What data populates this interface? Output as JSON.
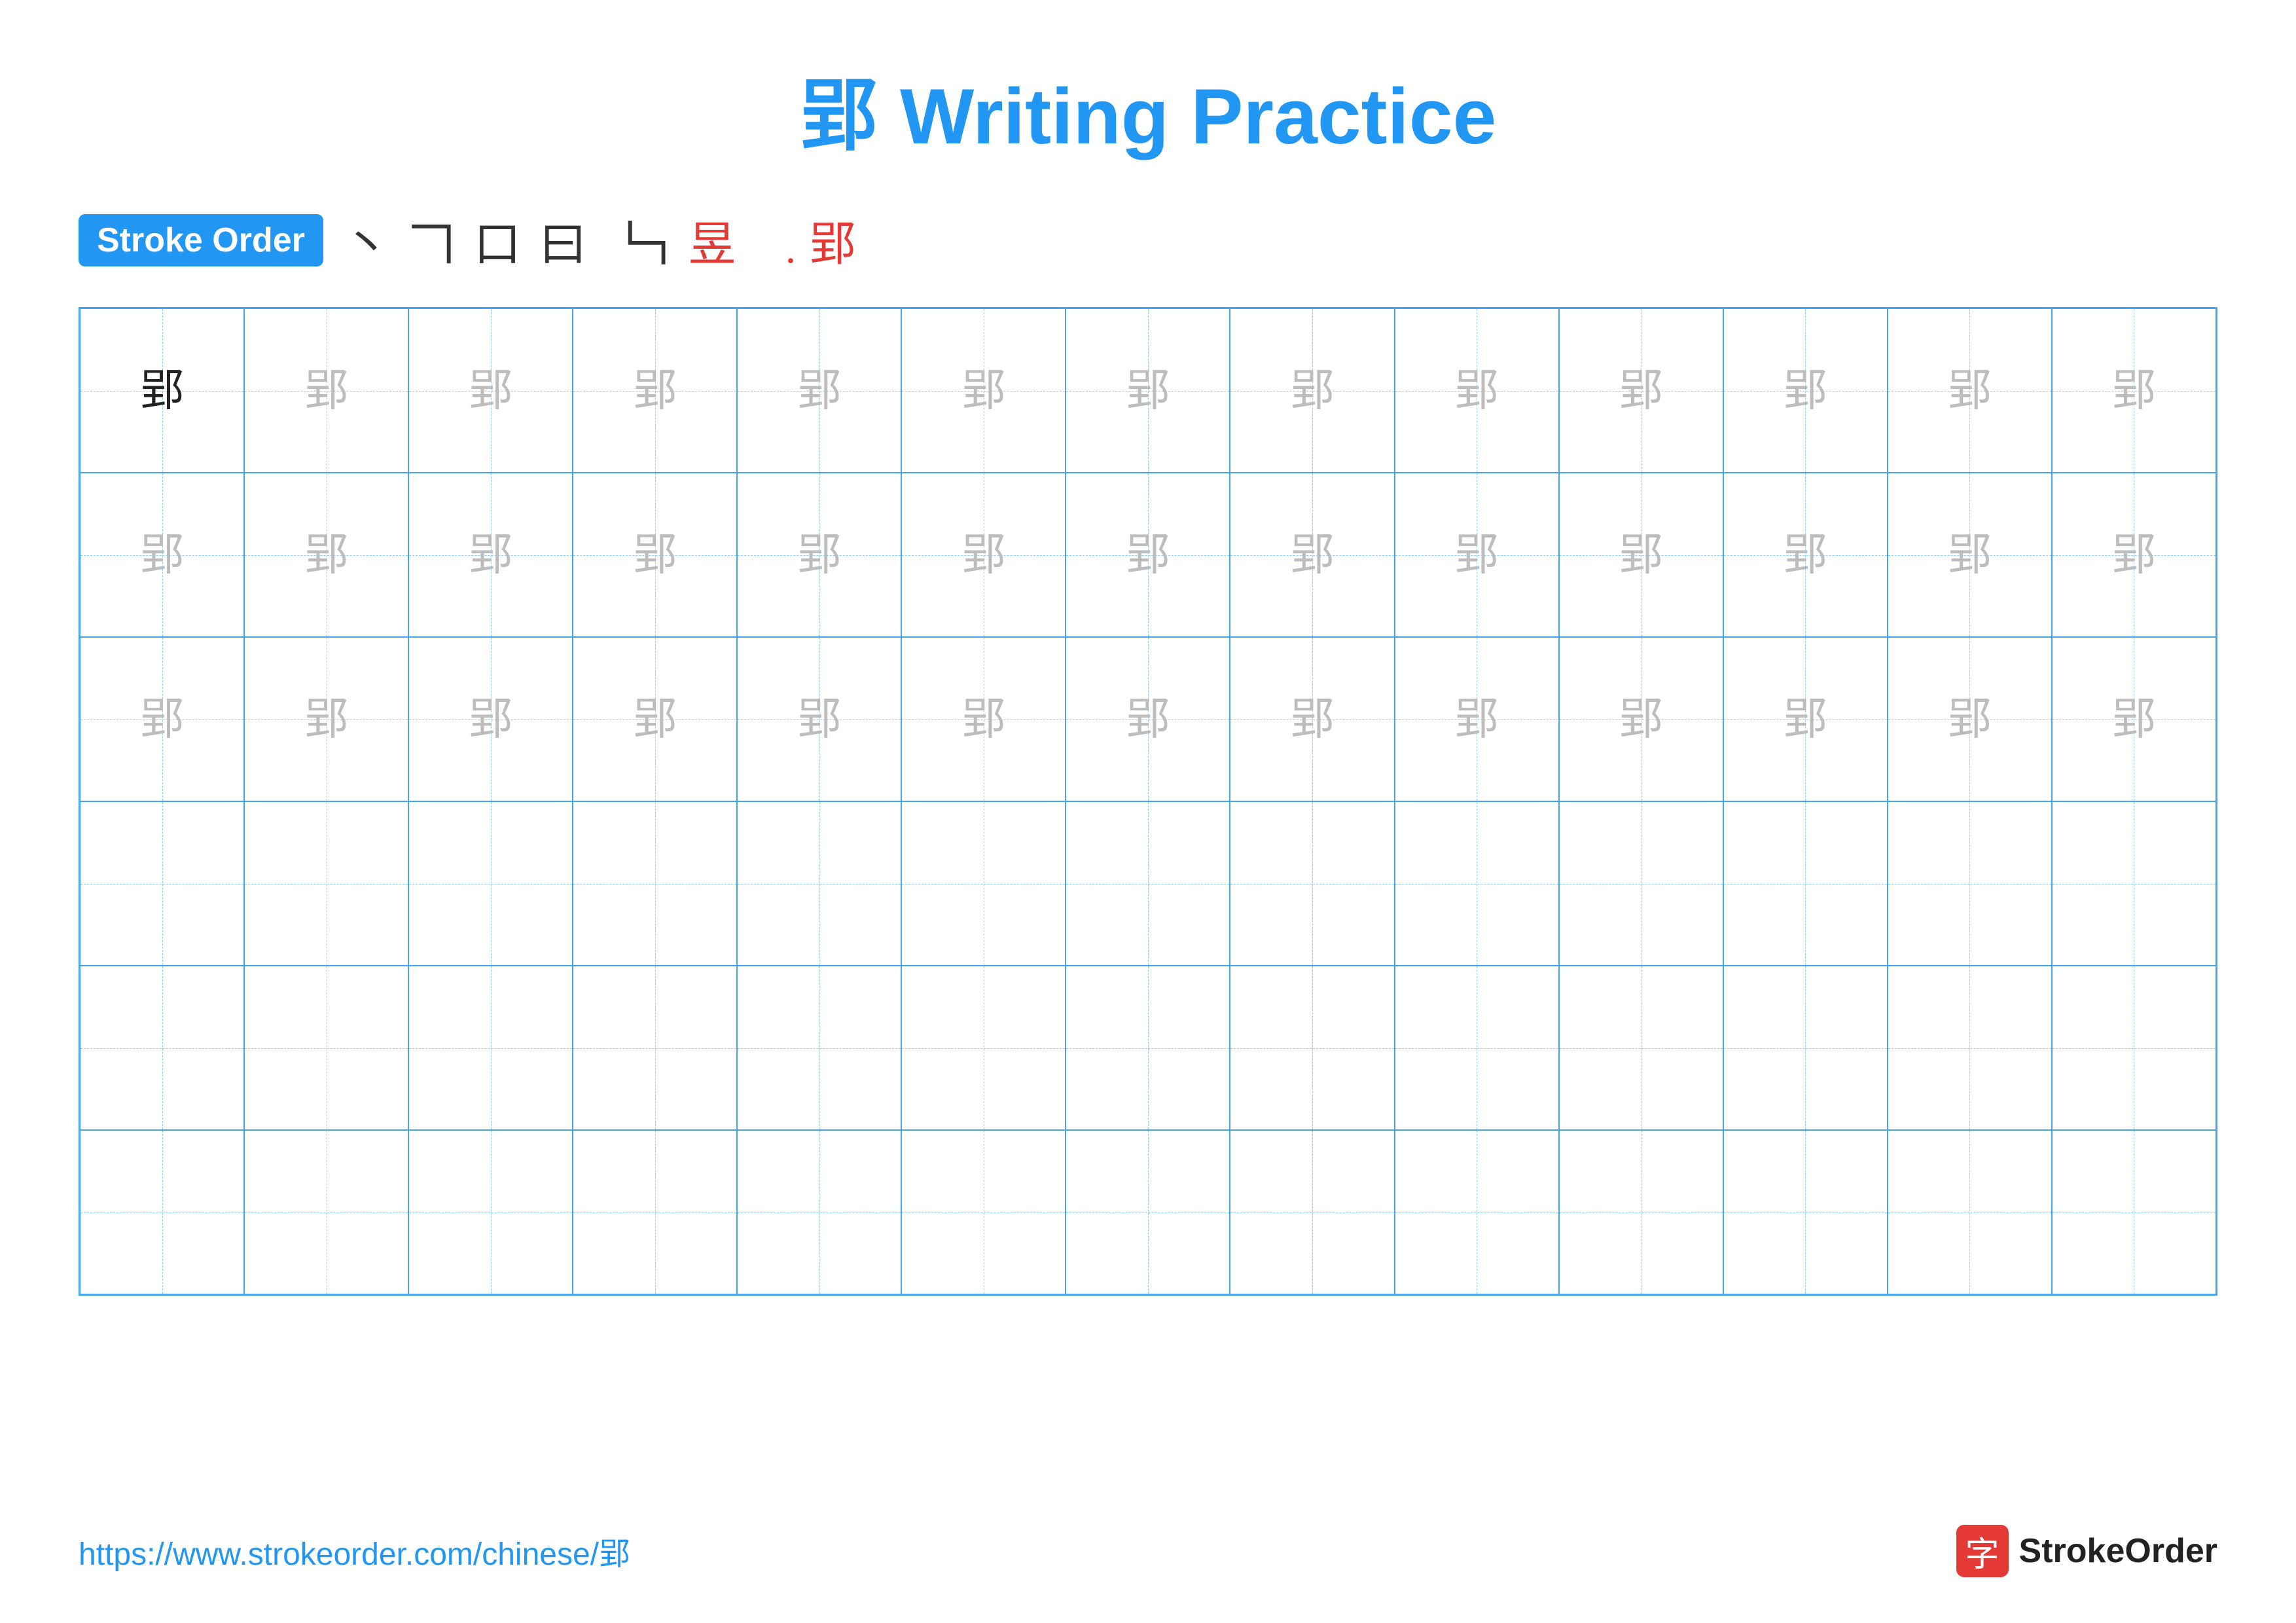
{
  "title": "郢 Writing Practice",
  "stroke_order_badge": "Stroke Order",
  "stroke_sequence": [
    "丶",
    "𠃍",
    "口",
    "曰",
    "𠃎",
    "𠃑",
    "𠃒",
    "郢̄",
    "郢"
  ],
  "character": "郢",
  "rows": [
    {
      "type": "practice",
      "cells": [
        {
          "char": "郢",
          "style": "dark"
        },
        {
          "char": "郢",
          "style": "light"
        },
        {
          "char": "郢",
          "style": "light"
        },
        {
          "char": "郢",
          "style": "light"
        },
        {
          "char": "郢",
          "style": "light"
        },
        {
          "char": "郢",
          "style": "light"
        },
        {
          "char": "郢",
          "style": "light"
        },
        {
          "char": "郢",
          "style": "light"
        },
        {
          "char": "郢",
          "style": "light"
        },
        {
          "char": "郢",
          "style": "light"
        },
        {
          "char": "郢",
          "style": "light"
        },
        {
          "char": "郢",
          "style": "light"
        },
        {
          "char": "郢",
          "style": "light"
        }
      ]
    },
    {
      "type": "practice",
      "cells": [
        {
          "char": "郢",
          "style": "light"
        },
        {
          "char": "郢",
          "style": "light"
        },
        {
          "char": "郢",
          "style": "light"
        },
        {
          "char": "郢",
          "style": "light"
        },
        {
          "char": "郢",
          "style": "light"
        },
        {
          "char": "郢",
          "style": "light"
        },
        {
          "char": "郢",
          "style": "light"
        },
        {
          "char": "郢",
          "style": "light"
        },
        {
          "char": "郢",
          "style": "light"
        },
        {
          "char": "郢",
          "style": "light"
        },
        {
          "char": "郢",
          "style": "light"
        },
        {
          "char": "郢",
          "style": "light"
        },
        {
          "char": "郢",
          "style": "light"
        }
      ]
    },
    {
      "type": "practice",
      "cells": [
        {
          "char": "郢",
          "style": "light"
        },
        {
          "char": "郢",
          "style": "light"
        },
        {
          "char": "郢",
          "style": "light"
        },
        {
          "char": "郢",
          "style": "light"
        },
        {
          "char": "郢",
          "style": "light"
        },
        {
          "char": "郢",
          "style": "light"
        },
        {
          "char": "郢",
          "style": "light"
        },
        {
          "char": "郢",
          "style": "light"
        },
        {
          "char": "郢",
          "style": "light"
        },
        {
          "char": "郢",
          "style": "light"
        },
        {
          "char": "郢",
          "style": "light"
        },
        {
          "char": "郢",
          "style": "light"
        },
        {
          "char": "郢",
          "style": "light"
        }
      ]
    },
    {
      "type": "empty"
    },
    {
      "type": "empty"
    },
    {
      "type": "empty"
    }
  ],
  "footer": {
    "url": "https://www.strokeorder.com/chinese/郢",
    "logo_char": "字",
    "logo_text": "StrokeOrder"
  }
}
